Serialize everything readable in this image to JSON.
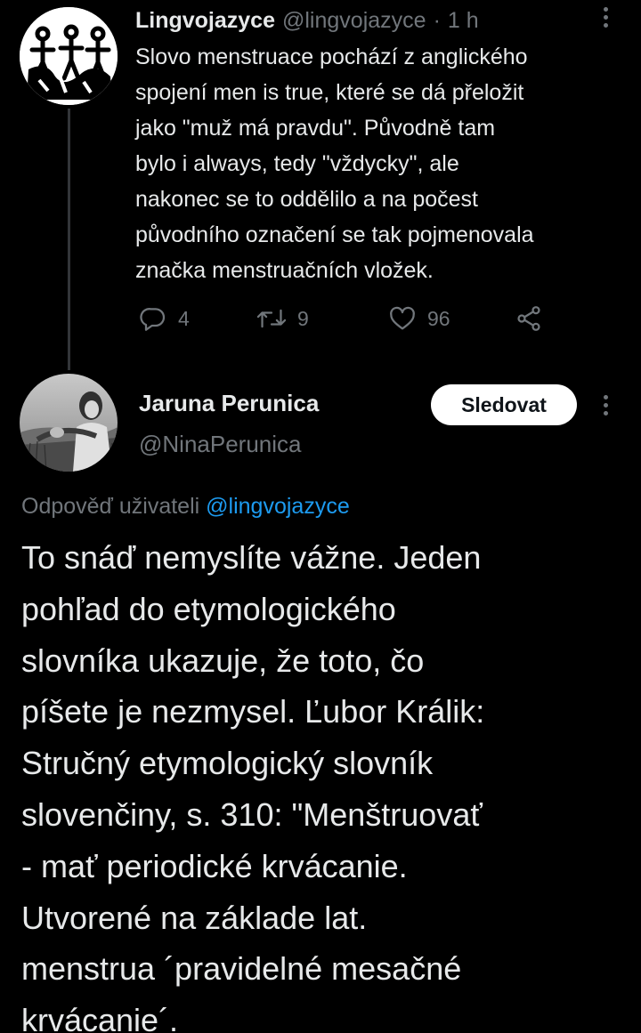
{
  "tweet": {
    "author_name": "Lingvojazyce",
    "author_handle": "@lingvojazyce",
    "separator": "·",
    "time": "1 h",
    "text_lines": [
      "Slovo menstruace pochází z anglického",
      "spojení men is true, které se dá přeložit",
      "jako \"muž má pravdu\". Původně tam",
      "bylo i always, tedy \"vždycky\", ale",
      "nakonec se to oddělilo a na počest",
      "původního označení se tak pojmenovala",
      "značka menstruačních vložek."
    ],
    "actions": {
      "replies": "4",
      "retweets": "9",
      "likes": "96"
    }
  },
  "reply": {
    "author_name": "Jaruna Perunica",
    "author_handle": "@NinaPerunica",
    "follow_label": "Sledovat",
    "reply_prefix": "Odpověď uživateli",
    "reply_mention": "@lingvojazyce",
    "text_lines": [
      "To snáď nemyslíte vážne. Jeden",
      "pohľad do etymologického",
      "slovníka ukazuje, že toto, čo",
      "píšete je nezmysel. Ľubor Králik:",
      "Stručný etymologický slovník",
      "slovenčiny, s. 310: \"Menštruovať",
      "- mať periodické krvácanie.",
      "Utvorené na základe lat.",
      "menstrua ´pravidelné mesačné",
      "krvácanie´."
    ]
  },
  "colors": {
    "background": "#000000",
    "primary_text": "#e7e9ea",
    "secondary_text": "#71767b",
    "link": "#1d9bf0",
    "follow_button_bg": "#ffffff"
  },
  "icons": [
    "more-icon",
    "reply-icon",
    "retweet-icon",
    "like-icon",
    "share-icon"
  ]
}
